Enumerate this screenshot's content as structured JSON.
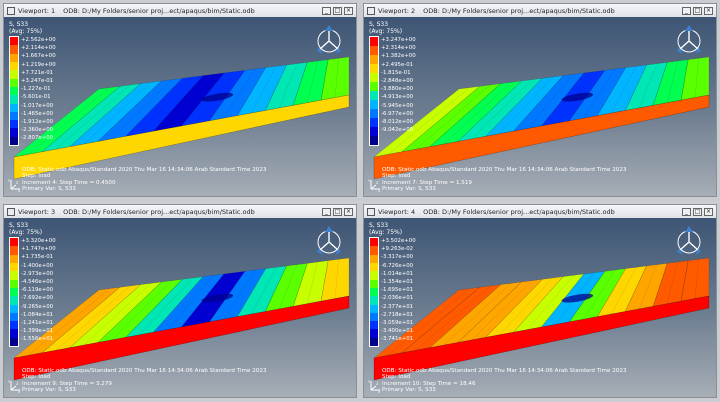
{
  "viewports": [
    {
      "title": "Viewport: 1",
      "path": "ODB: D:/My Folders/senior proj...ect/apaqus/bim/Static.odb",
      "legend_title": "S, S33",
      "legend_avg": "(Avg: 75%)",
      "legend_values": [
        "+2.562e+00",
        "+2.114e+00",
        "+1.667e+00",
        "+1.219e+00",
        "+7.721e-01",
        "+3.247e-01",
        "-1.227e-01",
        "-5.601e-01",
        "-1.017e+00",
        "-1.465e+00",
        "-1.912e+00",
        "-2.360e+00",
        "-2.807e+00"
      ],
      "footer_line1": "ODB: Static.odb    Abaqus/Standard 2020    Thu Mar 16 14:34:06 Arab Standard Time 2023",
      "footer_line2": "Step: load",
      "footer_line3": "Increment    4: Step Time =    0.4500",
      "footer_line4": "Primary Var: S, S33"
    },
    {
      "title": "Viewport: 2",
      "path": "ODB: D:/My Folders/senior proj...ect/apaqus/bim/Static.odb",
      "legend_title": "S, S33",
      "legend_avg": "(Avg: 75%)",
      "legend_values": [
        "+3.247e+00",
        "+2.314e+00",
        "+1.382e+00",
        "+2.495e-01",
        "-1.815e-01",
        "-2.848e+00",
        "-3.880e+00",
        "-4.913e+00",
        "-5.945e+00",
        "-6.977e+00",
        "-8.012e+00",
        "-9.042e+00"
      ],
      "footer_line1": "ODB: Static.odb    Abaqus/Standard 2020    Thu Mar 16 14:34:06 Arab Standard Time 2023",
      "footer_line2": "Step: load",
      "footer_line3": "Increment    7: Step Time =    1.519",
      "footer_line4": "Primary Var: S, S33"
    },
    {
      "title": "Viewport: 3",
      "path": "ODB: D:/My Folders/senior proj...ect/apaqus/bim/Static.odb",
      "legend_title": "S, S33",
      "legend_avg": "(Avg: 75%)",
      "legend_values": [
        "+3.320e+00",
        "+1.747e+00",
        "+1.735e-01",
        "-1.400e+00",
        "-2.973e+00",
        "-4.546e+00",
        "-6.119e+00",
        "-7.692e+00",
        "-9.265e+00",
        "-1.084e+01",
        "-1.241e+01",
        "-1.399e+01",
        "-1.556e+01"
      ],
      "footer_line1": "ODB: Static.odb    Abaqus/Standard 2020    Thu Mar 16 14:34:06 Arab Standard Time 2023",
      "footer_line2": "Step: load",
      "footer_line3": "Increment    9: Step Time =    3.279",
      "footer_line4": "Primary Var: S, S33"
    },
    {
      "title": "Viewport: 4",
      "path": "ODB: D:/My Folders/senior proj...ect/apaqus/bim/Static.odb",
      "legend_title": "S, S33",
      "legend_avg": "(Avg: 75%)",
      "legend_values": [
        "+3.502e+00",
        "+9.263e-02",
        "-3.317e+00",
        "-6.726e+00",
        "-1.014e+01",
        "-1.354e+01",
        "-1.695e+01",
        "-2.036e+01",
        "-2.377e+01",
        "-2.718e+01",
        "-3.059e+01",
        "-3.400e+01",
        "-3.741e+01"
      ],
      "footer_line1": "ODB: Static.odb    Abaqus/Standard 2020    Thu Mar 16 14:34:06 Arab Standard Time 2023",
      "footer_line2": "Step: load",
      "footer_line3": "Increment    10: Step Time =    18.46",
      "footer_line4": "Primary Var: S, S33"
    }
  ],
  "colors": {
    "contour": [
      "#ff0000",
      "#ff5a00",
      "#ffa500",
      "#ffd700",
      "#c8ff00",
      "#5aff00",
      "#00ff50",
      "#00e6b4",
      "#00b4ff",
      "#0078ff",
      "#0032ff",
      "#0000d2",
      "#00008c"
    ],
    "background_top": "#3d5574",
    "background_bottom": "#a7aeb6"
  },
  "icons": [
    "viewport-icon",
    "minimize-icon",
    "maximize-icon",
    "close-icon",
    "view-triad-icon",
    "axis-triad-icon"
  ]
}
